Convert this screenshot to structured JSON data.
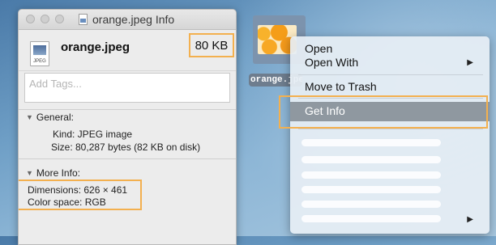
{
  "window": {
    "title": "orange.jpeg Info",
    "file_name": "orange.jpeg",
    "file_size": "80 KB",
    "file_icon_ext": "JPEG",
    "tags_placeholder": "Add Tags...",
    "general": {
      "heading": "General:",
      "kind": "Kind: JPEG image",
      "size": "Size: 80,287 bytes (82 KB on disk)"
    },
    "more_info": {
      "heading": "More Info:",
      "dimensions": "Dimensions: 626 × 461",
      "color_space": "Color space: RGB"
    }
  },
  "desktop_icon": {
    "label": "orange.jpeg"
  },
  "context_menu": {
    "items": [
      "Open",
      "Open With",
      "Move to Trash",
      "Get Info"
    ],
    "submenu_arrow": "▶",
    "placeholder_bars": 6
  },
  "colors": {
    "highlight_outline": "#f3b04f",
    "menu_selection": "#8f98a0"
  }
}
